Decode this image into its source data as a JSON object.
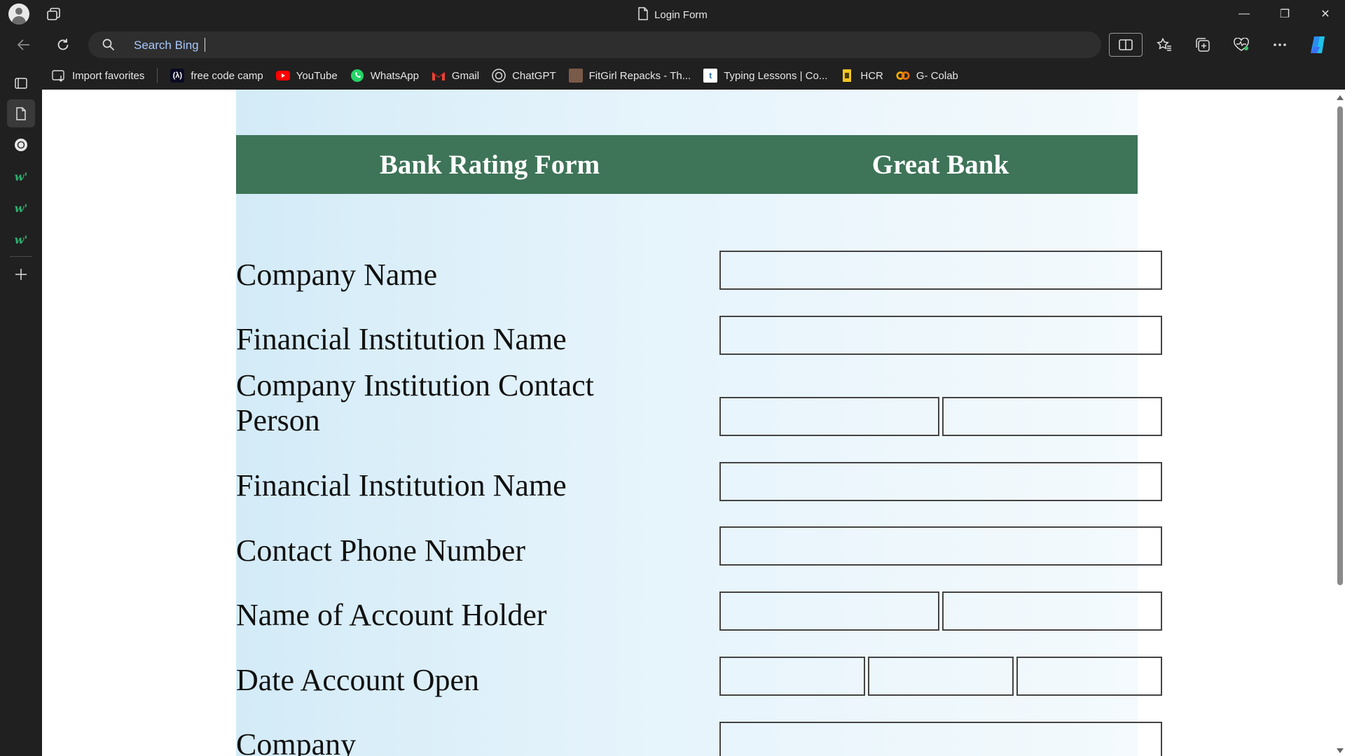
{
  "window": {
    "title": "Login Form",
    "minimize_glyph": "—",
    "maximize_glyph": "❐",
    "close_glyph": "✕"
  },
  "address_bar": {
    "text": "Search Bing"
  },
  "favorites": [
    {
      "label": "Import favorites",
      "icon": "import-icon"
    },
    {
      "label": "free code camp",
      "icon": "freecodecamp-icon"
    },
    {
      "label": "YouTube",
      "icon": "youtube-icon"
    },
    {
      "label": "WhatsApp",
      "icon": "whatsapp-icon"
    },
    {
      "label": "Gmail",
      "icon": "gmail-icon"
    },
    {
      "label": "ChatGPT",
      "icon": "chatgpt-icon"
    },
    {
      "label": "FitGirl Repacks - Th...",
      "icon": "fitgirl-icon"
    },
    {
      "label": "Typing Lessons | Co...",
      "icon": "typing-icon"
    },
    {
      "label": "HCR",
      "icon": "hcr-icon"
    },
    {
      "label": "G- Colab",
      "icon": "colab-icon"
    }
  ],
  "form": {
    "header_left": "Bank Rating Form",
    "header_right": "Great Bank",
    "rows": [
      {
        "label": "Company Name",
        "fields": 1
      },
      {
        "label": "Financial Institution Name",
        "fields": 1
      },
      {
        "label": "Company Institution Contact Person",
        "fields": 2
      },
      {
        "label": "Financial Institution Name",
        "fields": 1
      },
      {
        "label": "Contact Phone Number",
        "fields": 1
      },
      {
        "label": "Name of Account Holder",
        "fields": 2
      },
      {
        "label": "Date Account Open",
        "fields": 3
      },
      {
        "label": "Company",
        "fields": 1
      }
    ]
  },
  "colors": {
    "header_bg": "#3e7458",
    "form_bg_start": "#d3ebf7",
    "form_bg_end": "#f4fafd",
    "browser_chrome": "#202020"
  }
}
